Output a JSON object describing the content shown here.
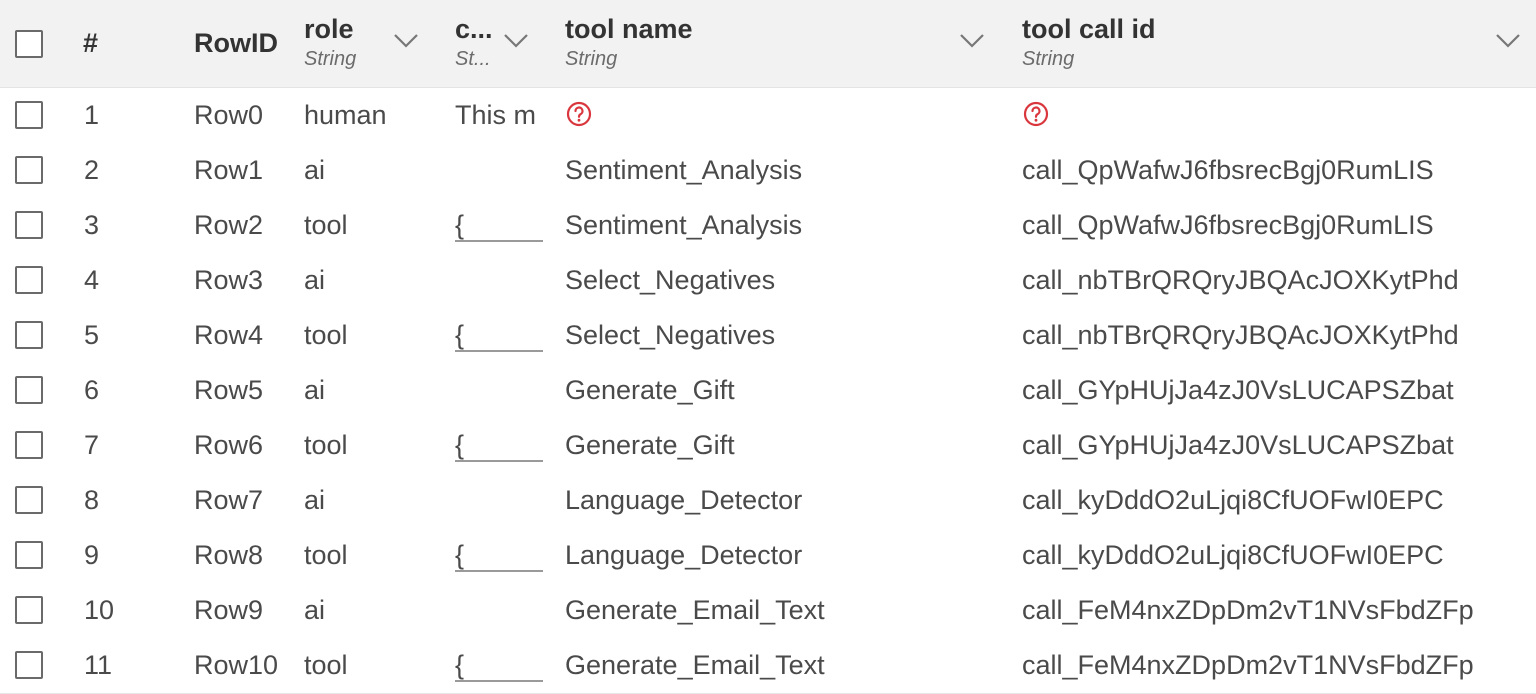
{
  "columns": {
    "index": {
      "label": "#"
    },
    "rowid": {
      "label": "RowID"
    },
    "role": {
      "label": "role",
      "type": "String"
    },
    "content": {
      "label": "c...",
      "type": "St..."
    },
    "tool_name": {
      "label": "tool name",
      "type": "String"
    },
    "tool_call_id": {
      "label": "tool call id",
      "type": "String"
    }
  },
  "rows": [
    {
      "index": "1",
      "rowid": "Row0",
      "role": "human",
      "content": "This m",
      "tool_name": null,
      "tool_call_id": null
    },
    {
      "index": "2",
      "rowid": "Row1",
      "role": "ai",
      "content": "",
      "tool_name": "Sentiment_Analysis",
      "tool_call_id": "call_QpWafwJ6fbsrecBgj0RumLIS"
    },
    {
      "index": "3",
      "rowid": "Row2",
      "role": "tool",
      "content": "{",
      "tool_name": "Sentiment_Analysis",
      "tool_call_id": "call_QpWafwJ6fbsrecBgj0RumLIS"
    },
    {
      "index": "4",
      "rowid": "Row3",
      "role": "ai",
      "content": "",
      "tool_name": "Select_Negatives",
      "tool_call_id": "call_nbTBrQRQryJBQAcJOXKytPhd"
    },
    {
      "index": "5",
      "rowid": "Row4",
      "role": "tool",
      "content": "{",
      "tool_name": "Select_Negatives",
      "tool_call_id": "call_nbTBrQRQryJBQAcJOXKytPhd"
    },
    {
      "index": "6",
      "rowid": "Row5",
      "role": "ai",
      "content": "",
      "tool_name": "Generate_Gift",
      "tool_call_id": "call_GYpHUjJa4zJ0VsLUCAPSZbat"
    },
    {
      "index": "7",
      "rowid": "Row6",
      "role": "tool",
      "content": "{",
      "tool_name": "Generate_Gift",
      "tool_call_id": "call_GYpHUjJa4zJ0VsLUCAPSZbat"
    },
    {
      "index": "8",
      "rowid": "Row7",
      "role": "ai",
      "content": "",
      "tool_name": "Language_Detector",
      "tool_call_id": "call_kyDddO2uLjqi8CfUOFwI0EPC"
    },
    {
      "index": "9",
      "rowid": "Row8",
      "role": "tool",
      "content": "{",
      "tool_name": "Language_Detector",
      "tool_call_id": "call_kyDddO2uLjqi8CfUOFwI0EPC"
    },
    {
      "index": "10",
      "rowid": "Row9",
      "role": "ai",
      "content": "",
      "tool_name": "Generate_Email_Text",
      "tool_call_id": "call_FeM4nxZDpDm2vT1NVsFbdZFp"
    },
    {
      "index": "11",
      "rowid": "Row10",
      "role": "tool",
      "content": "{",
      "tool_name": "Generate_Email_Text",
      "tool_call_id": "call_FeM4nxZDpDm2vT1NVsFbdZFp"
    }
  ],
  "icons": {
    "missing_value": "missing-value-icon",
    "sort_menu": "chevron-down-icon"
  },
  "colors": {
    "header_bg": "#f2f2f2",
    "missing_icon": "#d9363e",
    "border": "#e8e8e8"
  }
}
